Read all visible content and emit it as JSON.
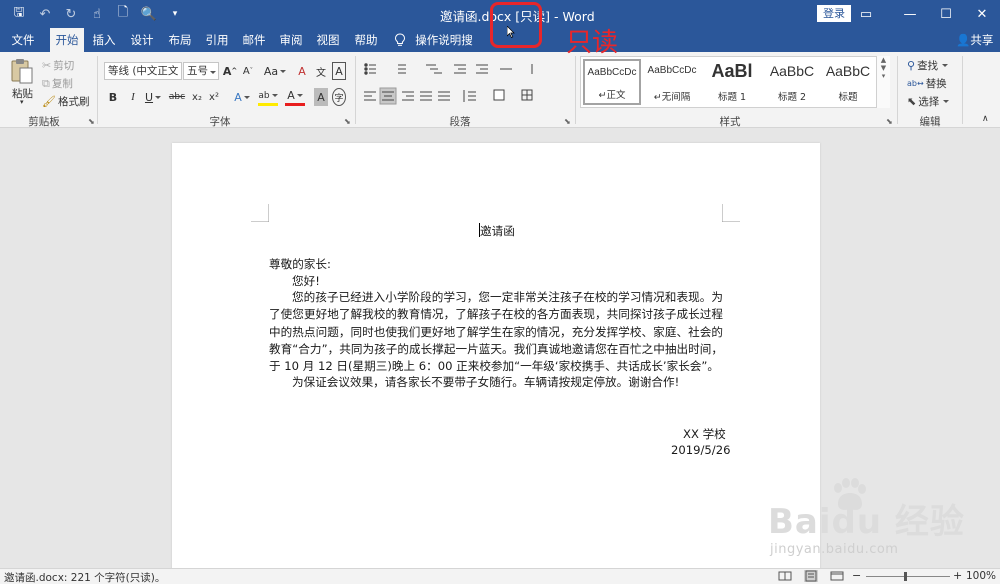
{
  "titlebar": {
    "title": "邀请函.docx  [只读]  -  Word",
    "login": "登录",
    "qat": {
      "save": "🖫",
      "undo": "↶",
      "redo": "↻",
      "touch": "☝",
      "new": "🗋",
      "preview": "🔍",
      "customize": "▾"
    },
    "controls": {
      "ribbon_options": "▭",
      "minimize": "—",
      "maximize": "☐",
      "close": "✕"
    }
  },
  "annotation": {
    "label": "只读",
    "color": "#e8262a"
  },
  "tabs": {
    "file": "文件",
    "home": "开始",
    "insert": "插入",
    "design": "设计",
    "layout": "布局",
    "references": "引用",
    "mailings": "邮件",
    "review": "审阅",
    "view": "视图",
    "help": "帮助",
    "tell_me": "操作说明搜索",
    "share": "共享"
  },
  "ribbon": {
    "clipboard": {
      "paste": "粘贴",
      "cut": "剪切",
      "copy": "复制",
      "format_painter": "格式刷",
      "label": "剪贴板"
    },
    "font": {
      "font_name": "等线 (中文正文",
      "font_size": "五号",
      "grow": "A",
      "shrink": "A",
      "case": "Aa",
      "clear": "A",
      "phonetic": "文",
      "border": "A",
      "bold": "B",
      "italic": "I",
      "underline": "U",
      "strike": "abc",
      "subscript": "x₂",
      "superscript": "x²",
      "effects": "A",
      "highlight": "ab",
      "color": "A",
      "shading": "A",
      "enclose": "字",
      "label": "字体"
    },
    "paragraph": {
      "label": "段落"
    },
    "styles": {
      "label": "样式",
      "items": [
        {
          "preview": "AaBbCcDc",
          "name": "↵正文"
        },
        {
          "preview": "AaBbCcDc",
          "name": "↵无间隔"
        },
        {
          "preview": "AaBl",
          "name": "标题 1"
        },
        {
          "preview": "AaBbC",
          "name": "标题 2"
        },
        {
          "preview": "AaBbC",
          "name": "标题"
        }
      ]
    },
    "editing": {
      "find": "查找",
      "replace": "替换",
      "select": "选择",
      "label": "编辑"
    }
  },
  "document": {
    "title": "邀请函",
    "salutation": "尊敬的家长:",
    "greeting": "您好!",
    "body1": "您的孩子已经进入小学阶段的学习，您一定非常关注孩子在校的学习情况和表现。为了使您更好地了解我校的教育情况，了解孩子在校的各方面表现，共同探讨孩子成长过程中的热点问题，同时也使我们更好地了解学生在家的情况，充分发挥学校、家庭、社会的教育“合力”，共同为孩子的成长撑起一片蓝天。我们真诚地邀请您在百忙之中抽出时间，于 10 月 12 日(星期三)晚上 6：00 正来校参加“一年级‘家校携手、共话成长’家长会”。",
    "body2": "为保证会议效果，请各家长不要带子女随行。车辆请按规定停放。谢谢合作!",
    "signature": "XX 学校",
    "date": "2019/5/26"
  },
  "watermark": {
    "main": "Baidu 经验",
    "sub": "jingyan.baidu.com"
  },
  "status": {
    "text": "邀请函.docx: 221 个字符(只读)。",
    "zoom": "100%"
  }
}
